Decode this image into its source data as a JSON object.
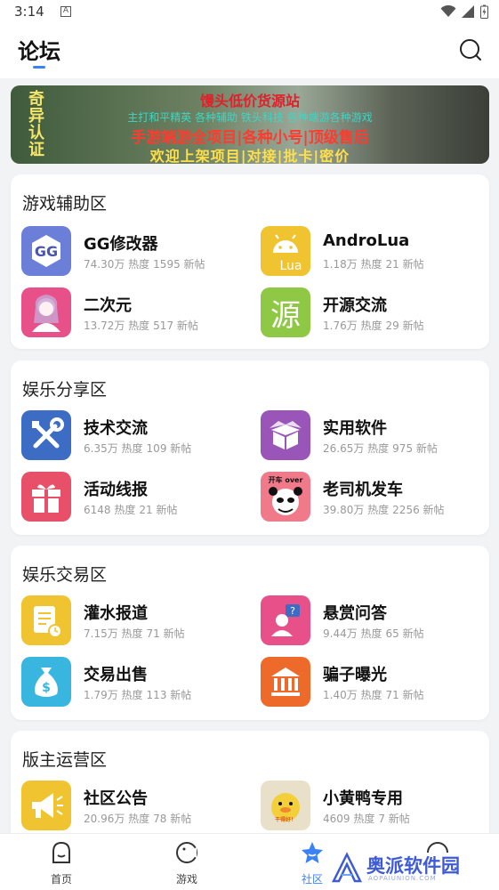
{
  "status": {
    "time": "3:14",
    "notif_glyph": "A"
  },
  "header": {
    "title": "论坛"
  },
  "banner": {
    "vertical_text": "奇异认证",
    "line1": "馒头低价货源站",
    "line2": "主打和平精英 各种辅助 铁头科技 各种端游各种游戏",
    "line3": "手游端游全项目|各种小号|顶级售后",
    "line4": "欢迎上架项目|对接|批卡|密价"
  },
  "sections": [
    {
      "title": "游戏辅助区",
      "forums": [
        {
          "name": "GG修改器",
          "heat": "74.30万 热度",
          "posts": "1595 新帖",
          "icon": "gg-icon",
          "color": "#6b7fd8"
        },
        {
          "name": "AndroLua",
          "heat": "1.18万 热度",
          "posts": "21 新帖",
          "icon": "android-lua-icon",
          "color": "#f0c330"
        },
        {
          "name": "二次元",
          "heat": "13.72万 热度",
          "posts": "517 新帖",
          "icon": "anime-girl-icon",
          "color": "#e8508a"
        },
        {
          "name": "开源交流",
          "heat": "1.76万 热度",
          "posts": "29 新帖",
          "icon": "source-char-icon",
          "color": "#8fc844",
          "char": "源"
        }
      ]
    },
    {
      "title": "娱乐分享区",
      "forums": [
        {
          "name": "技术交流",
          "heat": "6.35万 热度",
          "posts": "109 新帖",
          "icon": "tools-icon",
          "color": "#3d6cc4"
        },
        {
          "name": "实用软件",
          "heat": "26.65万 热度",
          "posts": "975 新帖",
          "icon": "box-icon",
          "color": "#9a55b8"
        },
        {
          "name": "活动线报",
          "heat": "6148 热度",
          "posts": "21 新帖",
          "icon": "gift-icon",
          "color": "#e8506a"
        },
        {
          "name": "老司机发车",
          "heat": "39.80万 热度",
          "posts": "2256 新帖",
          "icon": "panda-meme-icon",
          "color": "#f07a8a",
          "meme": "开车 over"
        }
      ]
    },
    {
      "title": "娱乐交易区",
      "forums": [
        {
          "name": "灌水报道",
          "heat": "7.15万 热度",
          "posts": "71 新帖",
          "icon": "document-icon",
          "color": "#f0c330"
        },
        {
          "name": "悬赏问答",
          "heat": "9.44万 热度",
          "posts": "65 新帖",
          "icon": "question-user-icon",
          "color": "#e8508a"
        },
        {
          "name": "交易出售",
          "heat": "1.79万 热度",
          "posts": "113 新帖",
          "icon": "money-bag-icon",
          "color": "#38b6e0"
        },
        {
          "name": "骗子曝光",
          "heat": "1.40万 热度",
          "posts": "71 新帖",
          "icon": "bank-icon",
          "color": "#ee6a2a"
        }
      ]
    },
    {
      "title": "版主运营区",
      "forums": [
        {
          "name": "社区公告",
          "heat": "20.96万 热度",
          "posts": "78 新帖",
          "icon": "megaphone-icon",
          "color": "#f0c330"
        },
        {
          "name": "小黄鸭专用",
          "heat": "4609 热度",
          "posts": "7 新帖",
          "icon": "duck-icon",
          "color": "#e8e0c8",
          "meme": "干得好！"
        }
      ]
    }
  ],
  "bottom_nav": [
    {
      "label": "首页",
      "icon": "home-icon"
    },
    {
      "label": "游戏",
      "icon": "game-icon"
    },
    {
      "label": "社区",
      "icon": "community-icon",
      "active": true
    },
    {
      "label": "",
      "icon": "profile-icon"
    }
  ],
  "watermark": {
    "text": "奥派软件园",
    "subtext": "AOPAIUNION.COM"
  },
  "colors": {
    "accent": "#3b82f6",
    "background": "#f2f3f5"
  }
}
